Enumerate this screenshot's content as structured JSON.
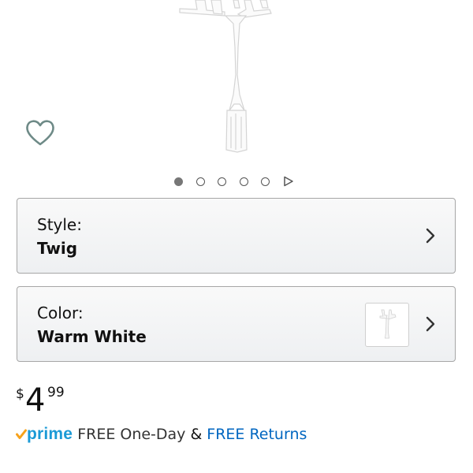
{
  "style": {
    "label": "Style:",
    "value": "Twig"
  },
  "color": {
    "label": "Color:",
    "value": "Warm White"
  },
  "price": {
    "currency": "$",
    "whole": "4",
    "fraction": "99"
  },
  "shipping": {
    "prime_label": "prime",
    "free_one_day": "FREE One-Day",
    "ampersand": "&",
    "free_returns": "FREE Returns"
  },
  "carousel": {
    "total_images": 5,
    "current_index": 1
  },
  "icons": {
    "wishlist": "heart-icon",
    "chevron": "chevron-right-icon",
    "play": "play-icon",
    "prime_check": "check-icon"
  },
  "colors": {
    "link": "#0066c0",
    "prime": "#1b9ad6",
    "prime_check": "#f7a21b"
  }
}
